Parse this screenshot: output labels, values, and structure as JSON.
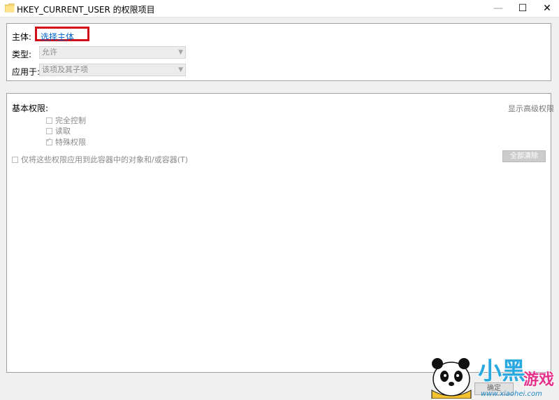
{
  "window": {
    "title": "HKEY_CURRENT_USER 的权限项目",
    "icon": "folder-icon",
    "controls": {
      "minimize": "—",
      "maximize": "☐",
      "close": "✕"
    }
  },
  "principal": {
    "label": "主体:",
    "value": "选择主体"
  },
  "type_field": {
    "label": "类型:",
    "value": "允许"
  },
  "applies_to": {
    "label": "应用于:",
    "value": "该项及其子项"
  },
  "basic_permissions": {
    "label": "基本权限:",
    "items": [
      {
        "label": "完全控制",
        "checked": false
      },
      {
        "label": "读取",
        "checked": false
      },
      {
        "label": "特殊权限",
        "checked": true
      }
    ]
  },
  "advanced_link": "显示高级权限",
  "apply_only": {
    "label": "仅将这些权限应用到此容器中的对象和/或容器(T)",
    "checked": false
  },
  "clear_all": "全部清除",
  "ok_button": "确定",
  "watermark": {
    "cn": "小黑游戏",
    "url": "www.xiaohei.com"
  },
  "colors": {
    "highlight": "#d10e17",
    "link": "#0066cc"
  }
}
